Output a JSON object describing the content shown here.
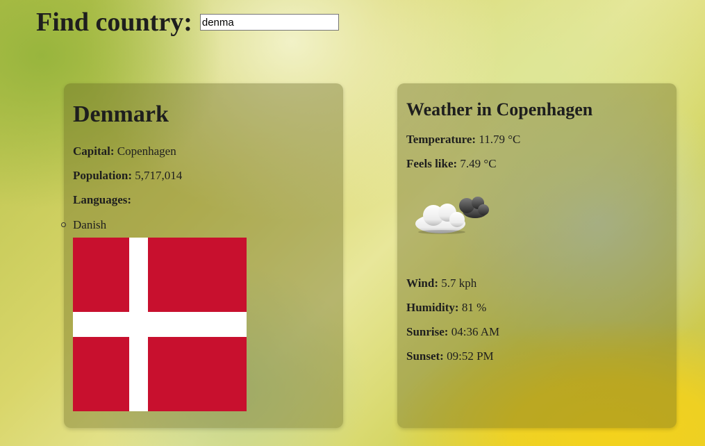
{
  "search": {
    "label": "Find country:",
    "value": "denma"
  },
  "country": {
    "name": "Denmark",
    "capital_label": "Capital:",
    "capital": "Copenhagen",
    "population_label": "Population:",
    "population": "5,717,014",
    "languages_label": "Languages:",
    "languages": [
      "Danish"
    ],
    "flag_icon": "flag-denmark-icon",
    "flag_colors": {
      "field": "#c8102e",
      "cross": "#ffffff"
    }
  },
  "weather": {
    "title": "Weather in Copenhagen",
    "temperature_label": "Temperature:",
    "temperature": "11.79 °C",
    "feels_like_label": "Feels like:",
    "feels_like": "7.49 °C",
    "icon": "partly-cloudy-icon",
    "wind_label": "Wind:",
    "wind": "5.7 kph",
    "humidity_label": "Humidity:",
    "humidity": "81 %",
    "sunrise_label": "Sunrise:",
    "sunrise": "04:36 AM",
    "sunset_label": "Sunset:",
    "sunset": "09:52 PM"
  }
}
